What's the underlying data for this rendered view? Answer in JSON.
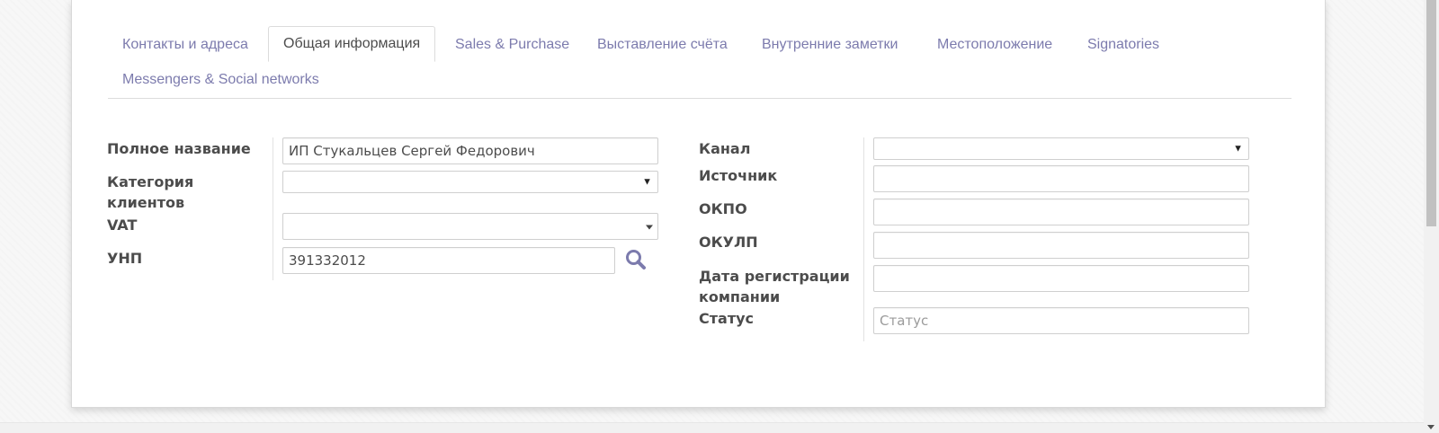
{
  "tabs": [
    {
      "label": "Контакты и адреса",
      "active": false
    },
    {
      "label": "Общая информация",
      "active": true
    },
    {
      "label": "Sales & Purchase",
      "active": false
    },
    {
      "label": "Выставление счёта",
      "active": false
    },
    {
      "label": "Внутренние заметки",
      "active": false
    },
    {
      "label": "Местоположение",
      "active": false
    },
    {
      "label": "Signatories",
      "active": false
    },
    {
      "label": "Messengers & Social networks",
      "active": false
    }
  ],
  "left_group": {
    "full_name": {
      "label": "Полное название",
      "value": "ИП Стукальцев Сергей Федорович"
    },
    "customer_category": {
      "label_line1": "Категория",
      "label_line2": "клиентов",
      "value": ""
    },
    "vat": {
      "label": "VAT",
      "value": ""
    },
    "unp": {
      "label": "УНП",
      "value": "391332012",
      "search_icon": "search-icon"
    }
  },
  "right_group": {
    "channel": {
      "label": "Канал",
      "value": ""
    },
    "source": {
      "label": "Источник",
      "value": ""
    },
    "okpo": {
      "label": "ОКПО",
      "value": ""
    },
    "okulp": {
      "label": "ОКУЛП",
      "value": ""
    },
    "reg_date": {
      "label_line1": "Дата регистрации",
      "label_line2": "компании",
      "value": ""
    },
    "status": {
      "label": "Статус",
      "value": "",
      "placeholder": "Статус"
    }
  },
  "colors": {
    "tab_link": "#7c7bad",
    "text": "#4c4c4c",
    "accent_icon": "#7c7bad"
  }
}
